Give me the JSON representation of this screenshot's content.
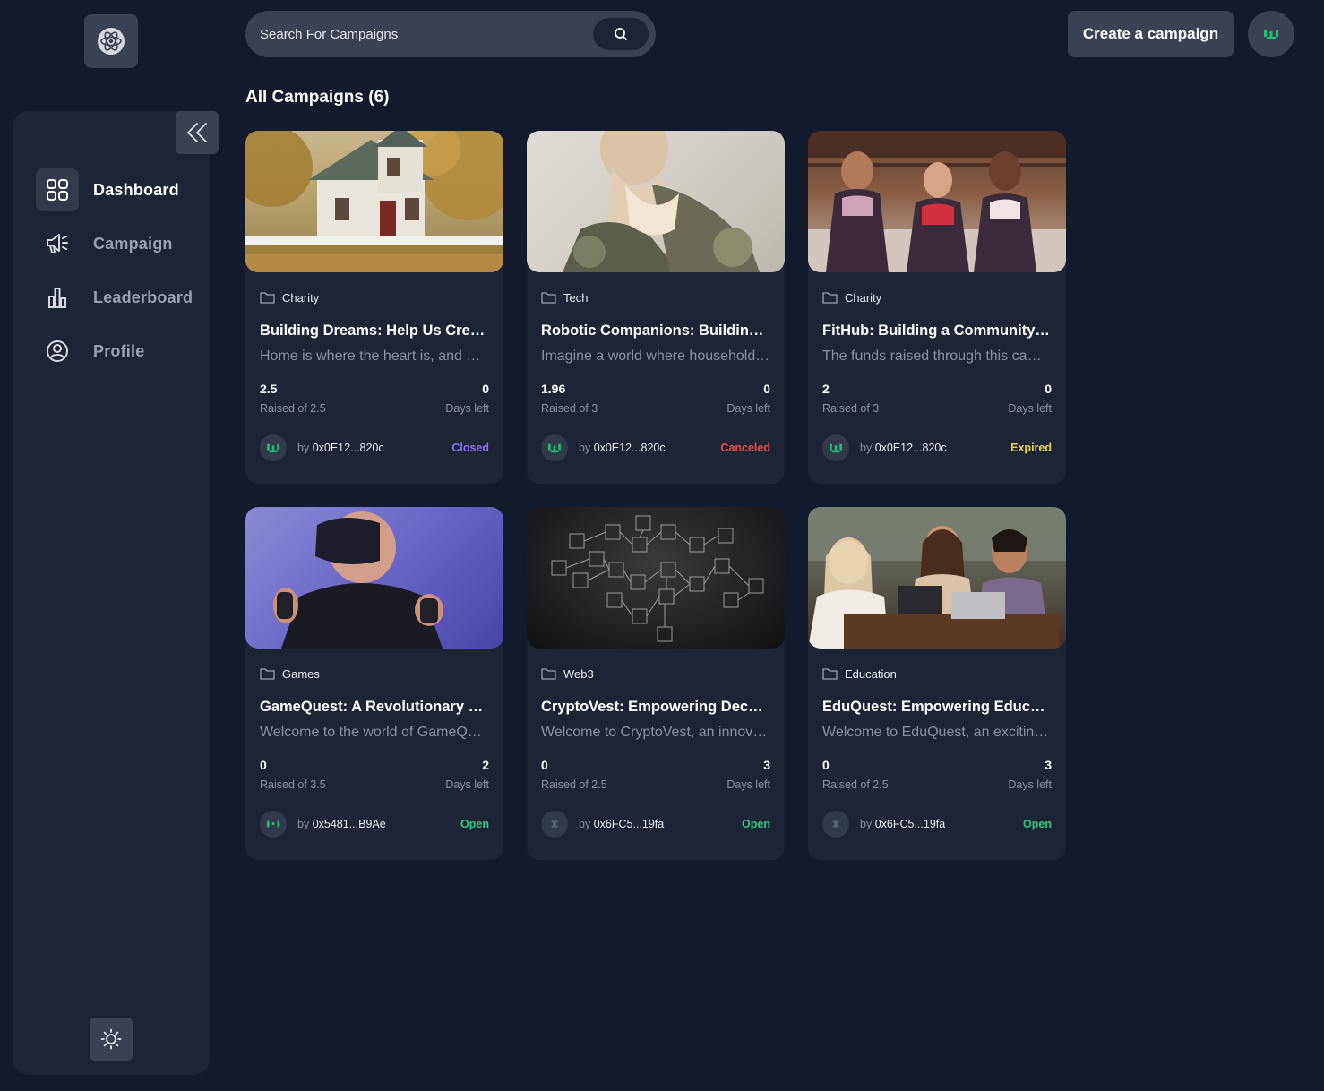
{
  "search": {
    "placeholder": "Search For Campaigns",
    "icon": "search-icon"
  },
  "header": {
    "create_label": "Create a campaign"
  },
  "sidebar": {
    "items": [
      {
        "label": "Dashboard",
        "icon": "dashboard-grid-icon",
        "active": true
      },
      {
        "label": "Campaign",
        "icon": "megaphone-icon"
      },
      {
        "label": "Leaderboard",
        "icon": "bar-chart-icon"
      },
      {
        "label": "Profile",
        "icon": "user-circle-icon"
      }
    ]
  },
  "main": {
    "title": "All Campaigns (6)"
  },
  "colors": {
    "closed": "#8c6dfd",
    "canceled": "#f04848",
    "expired": "#e6d24a",
    "open": "#2fc783",
    "accent": "#1dc071"
  },
  "campaigns": [
    {
      "category": "Charity",
      "title": "Building Dreams: Help Us Create a Home",
      "description": "Home is where the heart is, and we need your help",
      "raised": "2.5",
      "raised_label": "Raised of 2.5",
      "days": "0",
      "days_label": "Days left",
      "by_prefix": "by",
      "owner": "0x0E12...820c",
      "status": "Closed",
      "image": "house"
    },
    {
      "category": "Tech",
      "title": "Robotic Companions: Building the Future",
      "description": "Imagine a world where household robots help",
      "raised": "1.96",
      "raised_label": "Raised of 3",
      "days": "0",
      "days_label": "Days left",
      "by_prefix": "by",
      "owner": "0x0E12...820c",
      "status": "Canceled",
      "image": "robot"
    },
    {
      "category": "Charity",
      "title": "FitHub: Building a Community of Fitness",
      "description": "The funds raised through this campaign",
      "raised": "2",
      "raised_label": "Raised of 3",
      "days": "0",
      "days_label": "Days left",
      "by_prefix": "by",
      "owner": "0x0E12...820c",
      "status": "Expired",
      "image": "fitness"
    },
    {
      "category": "Games",
      "title": "GameQuest: A Revolutionary Fantasy Game",
      "description": "Welcome to the world of GameQuest",
      "raised": "0",
      "raised_label": "Raised of 3.5",
      "days": "2",
      "days_label": "Days left",
      "by_prefix": "by",
      "owner": "0x5481...B9Ae",
      "status": "Open",
      "image": "vr"
    },
    {
      "category": "Web3",
      "title": "CryptoVest: Empowering Decentralized Finance",
      "description": "Welcome to CryptoVest, an innovative platform",
      "raised": "0",
      "raised_label": "Raised of 2.5",
      "days": "3",
      "days_label": "Days left",
      "by_prefix": "by",
      "owner": "0x6FC5...19fa",
      "status": "Open",
      "image": "blockchain"
    },
    {
      "category": "Education",
      "title": "EduQuest: Empowering Education for All",
      "description": "Welcome to EduQuest, an exciting platform",
      "raised": "0",
      "raised_label": "Raised of 2.5",
      "days": "3",
      "days_label": "Days left",
      "by_prefix": "by",
      "owner": "0x6FC5...19fa",
      "status": "Open",
      "image": "education"
    }
  ]
}
